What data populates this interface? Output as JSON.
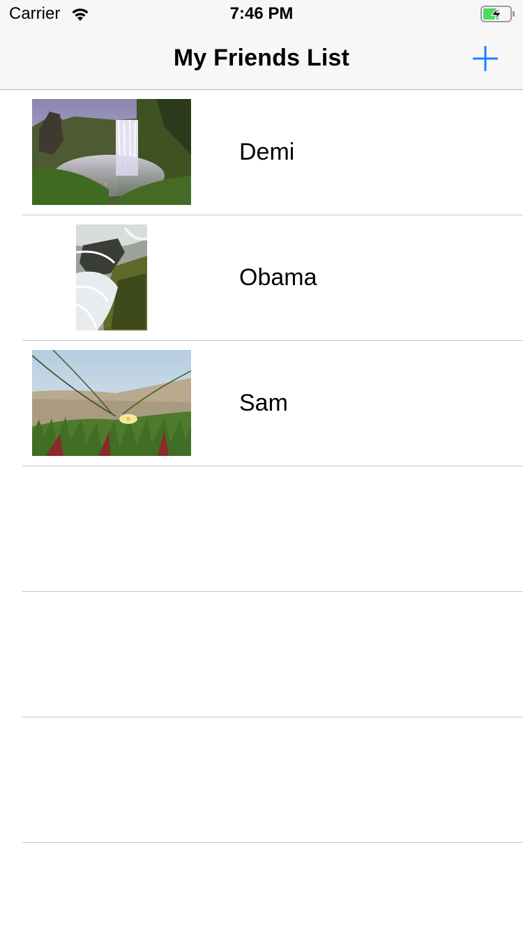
{
  "status_bar": {
    "carrier": "Carrier",
    "time": "7:46 PM"
  },
  "nav": {
    "title": "My Friends List",
    "add_icon": "plus-icon",
    "accent": "#1a82fb"
  },
  "friends": [
    {
      "name": "Demi",
      "photo": "waterfall-cliff"
    },
    {
      "name": "Obama",
      "photo": "waterfall-rocks"
    },
    {
      "name": "Sam",
      "photo": "flower-dunes"
    }
  ]
}
